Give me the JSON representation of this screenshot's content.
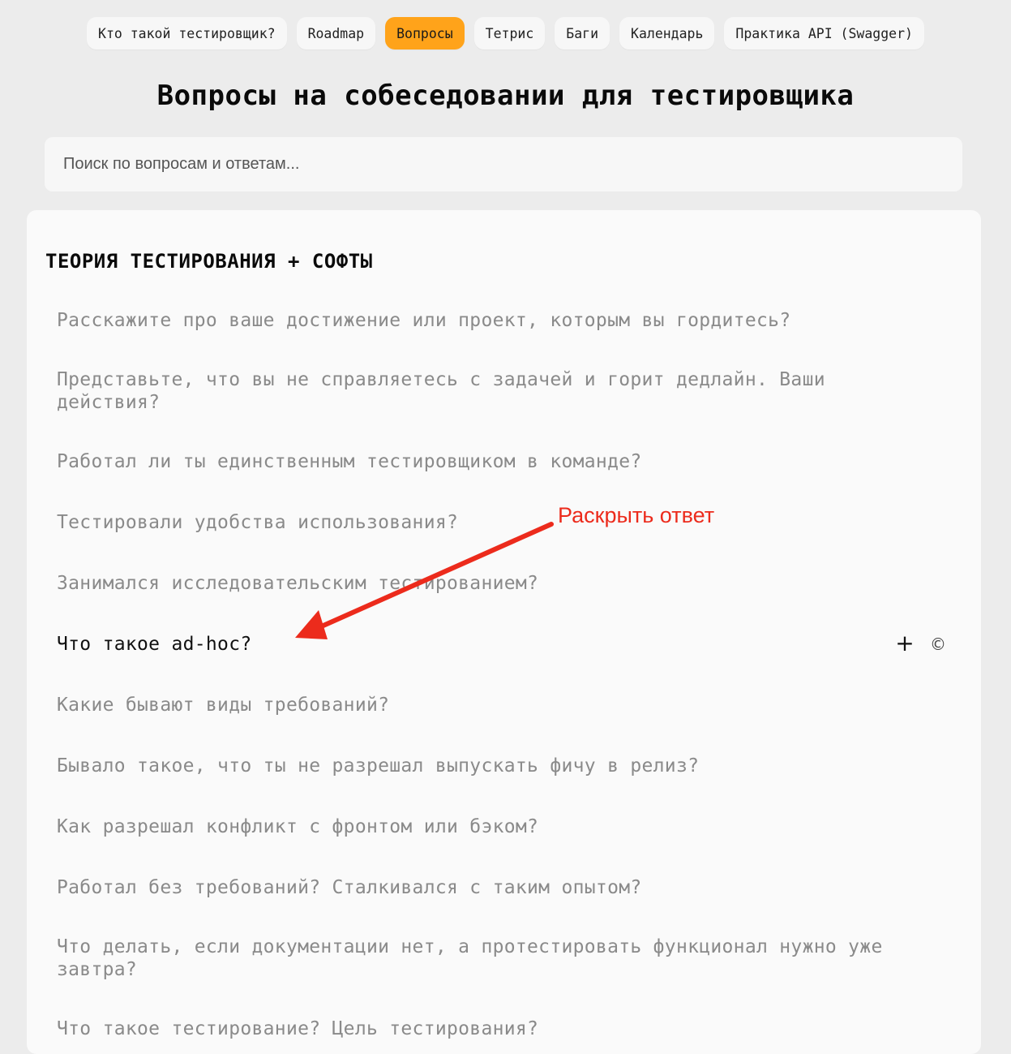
{
  "nav": {
    "items": [
      {
        "label": "Кто такой тестировщик?",
        "active": false
      },
      {
        "label": "Roadmap",
        "active": false
      },
      {
        "label": "Вопросы",
        "active": true
      },
      {
        "label": "Тетрис",
        "active": false
      },
      {
        "label": "Баги",
        "active": false
      },
      {
        "label": "Календарь",
        "active": false
      },
      {
        "label": "Практика API (Swagger)",
        "active": false
      }
    ],
    "active_color": "#ffa31a"
  },
  "page": {
    "title": "Вопросы на собеседовании для тестировщика"
  },
  "search": {
    "placeholder": "Поиск по вопросам и ответам..."
  },
  "section": {
    "title": "ТЕОРИЯ ТЕСТИРОВАНИЯ + СОФТЫ",
    "questions": [
      "Расскажите про ваше достижение или проект, которым вы гордитесь?",
      "Представьте, что вы не справляетесь с задачей и горит дедлайн. Ваши действия?",
      "Работал ли ты единственным тестировщиком в команде?",
      "Тестировали удобства использования?",
      "Занимался исследовательским тестированием?",
      "Что такое ad-hoc?",
      "Какие бывают виды требований?",
      "Бывало такое, что ты не разрешал выпускать фичу в релиз?",
      "Как разрешал конфликт с фронтом или бэком?",
      "Работал без требований? Сталкивался с таким опытом?",
      "Что делать, если документации нет, а протестировать функционал нужно уже завтра?",
      "Что такое тестирование? Цель тестирования?"
    ],
    "active_index": 5
  },
  "item_icons": {
    "expand": "plus-icon",
    "copyright": "copyright-icon",
    "expand_glyph": "+",
    "copyright_glyph": "©"
  },
  "annotation": {
    "label": "Раскрыть ответ",
    "color": "#ec2b1c"
  }
}
